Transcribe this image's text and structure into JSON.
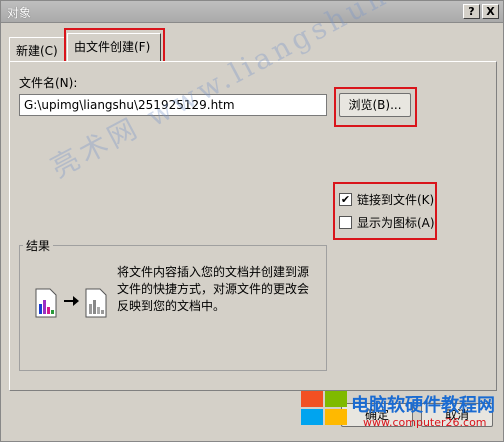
{
  "window": {
    "title": "对象",
    "help_btn": "?",
    "close_btn": "X"
  },
  "tabs": [
    {
      "label": "新建(C)"
    },
    {
      "label": "由文件创建(F)"
    }
  ],
  "file": {
    "label": "文件名(N):",
    "value": "G:\\upimg\\liangshu\\251925129.htm",
    "browse": "浏览(B)..."
  },
  "options": {
    "link": {
      "label": "链接到文件(K)",
      "checked": true
    },
    "icon": {
      "label": "显示为图标(A)",
      "checked": false
    }
  },
  "result": {
    "title": "结果",
    "text": "将文件内容插入您的文档并创建到源文件的快捷方式，对源文件的更改会反映到您的文档中。"
  },
  "buttons": {
    "ok": "确定",
    "cancel": "取消"
  },
  "watermark": {
    "text": "亮术网 www.liangshunet.com"
  },
  "site": {
    "name": "电脑软硬件教程网",
    "url": "www.computer26.com"
  },
  "colors": {
    "highlight": "#d9141b",
    "logo_blue": "#1a6bd1"
  }
}
